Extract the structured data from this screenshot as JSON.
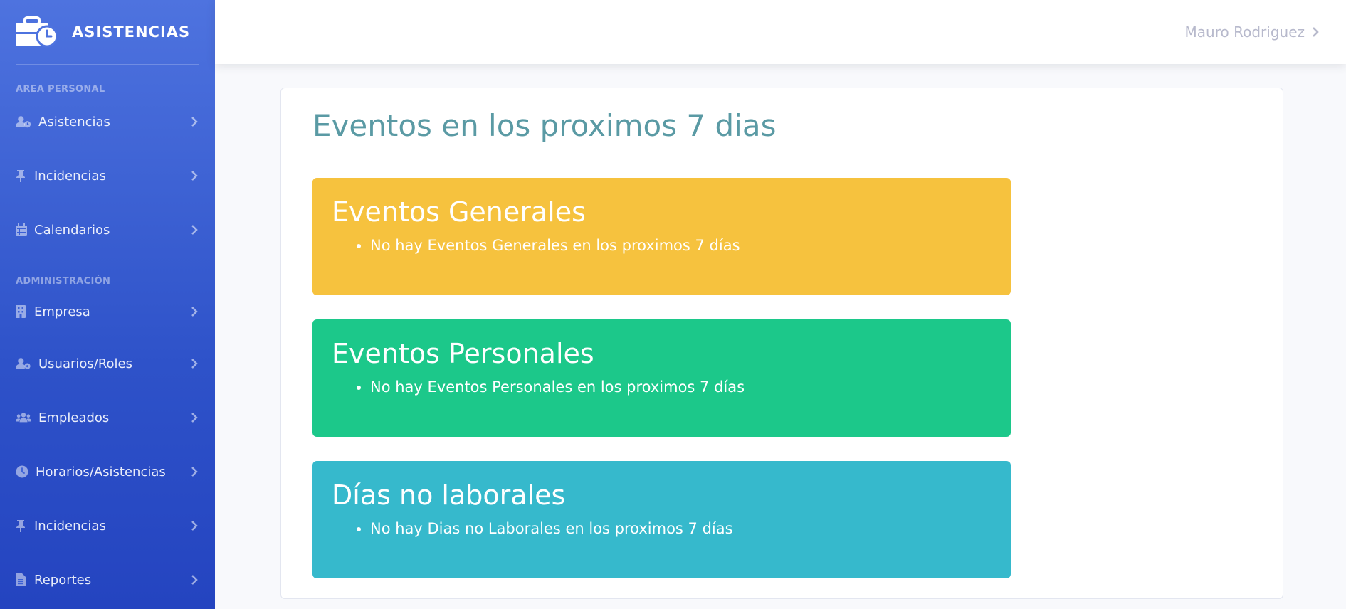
{
  "brand": {
    "title": "ASISTENCIAS",
    "icon": "briefcase-clock-icon"
  },
  "sidebar": {
    "sections": [
      {
        "heading": "AREA PERSONAL",
        "items": [
          {
            "label": "Asistencias",
            "icon": "user-clock-icon"
          },
          {
            "label": "Incidencias",
            "icon": "thumbtack-icon"
          },
          {
            "label": "Calendarios",
            "icon": "calendar-icon"
          }
        ]
      },
      {
        "heading": "ADMINISTRACIÓN",
        "items": [
          {
            "label": "Empresa",
            "icon": "building-icon"
          },
          {
            "label": "Usuarios/Roles",
            "icon": "user-cog-icon"
          },
          {
            "label": "Empleados",
            "icon": "users-icon"
          },
          {
            "label": "Horarios/Asistencias",
            "icon": "clock-icon"
          },
          {
            "label": "Incidencias",
            "icon": "thumbtack-icon"
          },
          {
            "label": "Reportes",
            "icon": "file-icon"
          }
        ]
      }
    ]
  },
  "topbar": {
    "user_name": "Mauro Rodriguez"
  },
  "main": {
    "title": "Eventos en los proximos 7 dias",
    "boxes": [
      {
        "title": "Eventos Generales",
        "message": "No hay Eventos Generales en los proximos 7 días",
        "color": "#f6c23e"
      },
      {
        "title": "Eventos Personales",
        "message": "No hay Eventos Personales en los proximos 7 días",
        "color": "#1cc88a"
      },
      {
        "title": "Días no laborales",
        "message": "No hay Dias no Laborales en los proximos 7 días",
        "color": "#36b9cc"
      }
    ]
  }
}
